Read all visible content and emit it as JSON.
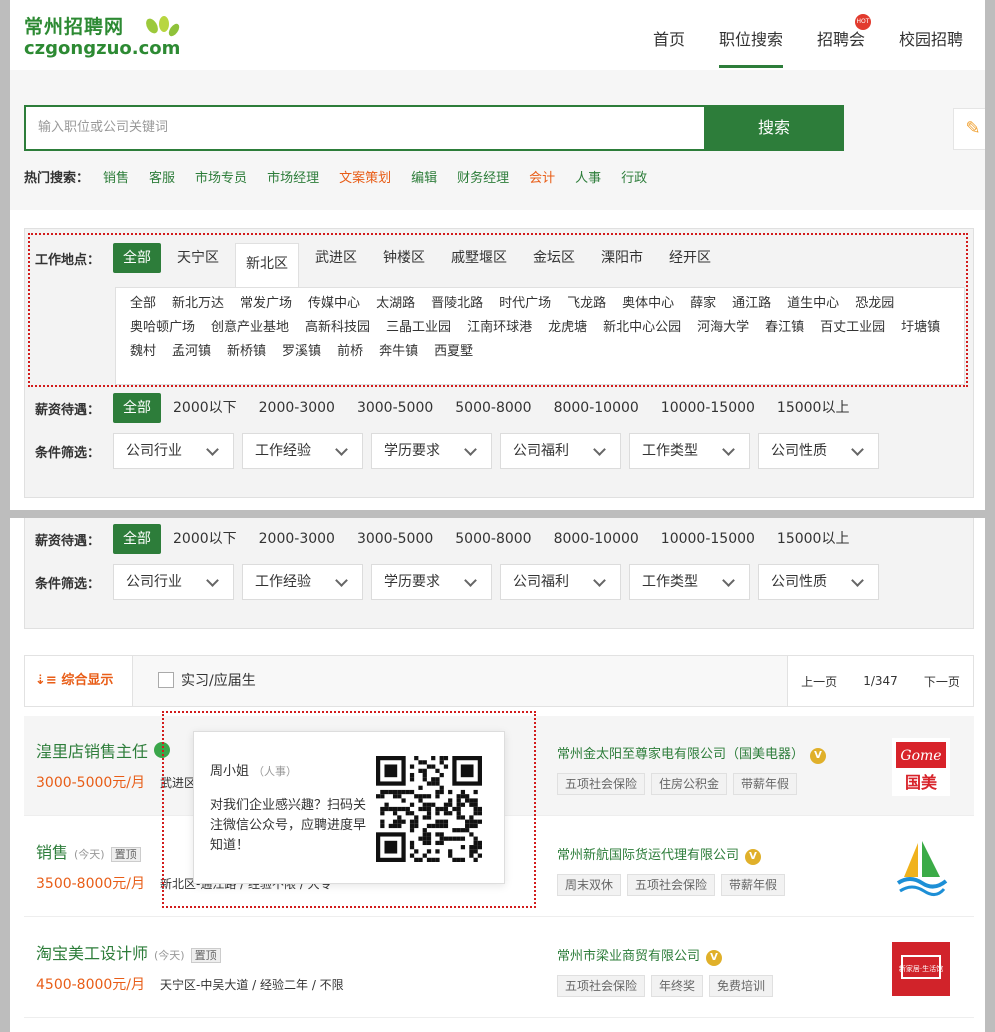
{
  "header": {
    "logo_cn": "常州招聘网",
    "logo_en": "czgongzuo.com",
    "nav": [
      "首页",
      "职位搜索",
      "招聘会",
      "校园招聘"
    ],
    "nav_hot_badge": "HOT"
  },
  "search": {
    "placeholder": "输入职位或公司关键词",
    "button": "搜索",
    "hot_label": "热门搜索：",
    "hot_terms": [
      {
        "t": "销售",
        "c": "green"
      },
      {
        "t": "客服",
        "c": "green"
      },
      {
        "t": "市场专员",
        "c": "green"
      },
      {
        "t": "市场经理",
        "c": "green"
      },
      {
        "t": "文案策划",
        "c": "orange"
      },
      {
        "t": "编辑",
        "c": "green"
      },
      {
        "t": "财务经理",
        "c": "green"
      },
      {
        "t": "会计",
        "c": "orange"
      },
      {
        "t": "人事",
        "c": "green"
      },
      {
        "t": "行政",
        "c": "green"
      }
    ]
  },
  "filter": {
    "location_label": "工作地点：",
    "locations": [
      "全部",
      "天宁区",
      "新北区",
      "武进区",
      "钟楼区",
      "戚墅堰区",
      "金坛区",
      "溧阳市",
      "经开区"
    ],
    "sub_locations": [
      "全部",
      "新北万达",
      "常发广场",
      "传媒中心",
      "太湖路",
      "晋陵北路",
      "时代广场",
      "飞龙路",
      "奥体中心",
      "薛家",
      "通江路",
      "道生中心",
      "恐龙园",
      "奥哈顿广场",
      "创意产业基地",
      "高新科技园",
      "三晶工业园",
      "江南环球港",
      "龙虎塘",
      "新北中心公园",
      "河海大学",
      "春江镇",
      "百丈工业园",
      "圩塘镇",
      "魏村",
      "孟河镇",
      "新桥镇",
      "罗溪镇",
      "前桥",
      "奔牛镇",
      "西夏墅"
    ],
    "salary_label": "薪资待遇：",
    "salaries": [
      "全部",
      "2000以下",
      "2000-3000",
      "3000-5000",
      "5000-8000",
      "8000-10000",
      "10000-15000",
      "15000以上"
    ],
    "cond_label": "条件筛选：",
    "conditions": [
      "公司行业",
      "工作经验",
      "学历要求",
      "公司福利",
      "工作类型",
      "公司性质"
    ]
  },
  "toolbar": {
    "sort": "综合显示",
    "intern": "实习/应届生",
    "prev": "上一页",
    "page": "1/347",
    "next": "下一页"
  },
  "jobs": [
    {
      "title": "湟里店销售主任",
      "salary": "3000-5000元/月",
      "meta": "武进区",
      "company": "常州金太阳至尊家电有限公司（国美电器）",
      "tags": [
        "五项社会保险",
        "住房公积金",
        "带薪年假"
      ],
      "logo": "Gome 国美"
    },
    {
      "title": "销售",
      "when": "(今天)",
      "top": "置顶",
      "salary": "3500-8000元/月",
      "meta": "新北区-通江路 / 经验不限 / 大专",
      "company": "常州新航国际货运代理有限公司",
      "tags": [
        "周末双休",
        "五项社会保险",
        "带薪年假"
      ]
    },
    {
      "title": "淘宝美工设计师",
      "when": "(今天)",
      "top": "置顶",
      "salary": "4500-8000元/月",
      "meta": "天宁区-中吴大道 / 经验二年 / 不限",
      "company": "常州市梁业商贸有限公司",
      "tags": [
        "五项社会保险",
        "年终奖",
        "免费培训"
      ],
      "logo": "新家居·生活馆"
    }
  ],
  "popup": {
    "name": "周小姐",
    "role": "（人事）",
    "msg": "对我们企业感兴趣？扫码关注微信公众号，应聘进度早知道！"
  },
  "colors": {
    "brand": "#2d7d3a",
    "accent": "#e85d17",
    "dotted": "#d21c1c"
  },
  "vbadge": "V"
}
